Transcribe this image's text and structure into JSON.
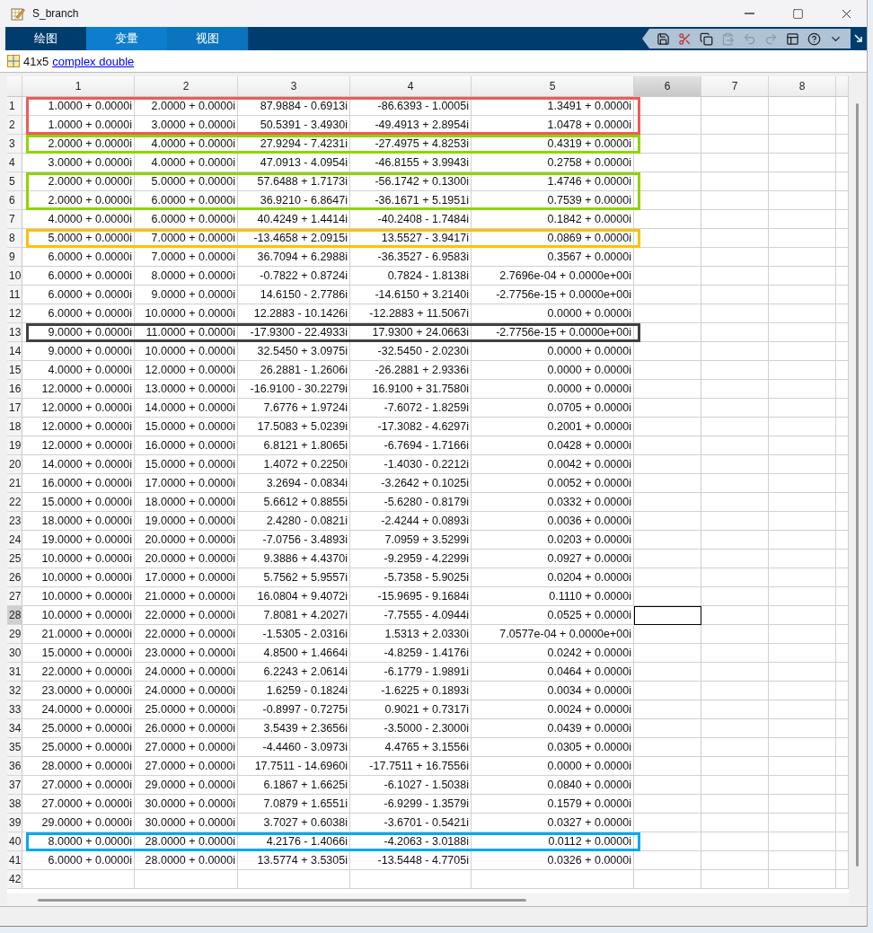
{
  "window": {
    "title": "S_branch"
  },
  "tabs": [
    {
      "label": "绘图",
      "selected": false,
      "highlighted": false
    },
    {
      "label": "变量",
      "selected": true,
      "highlighted": true
    },
    {
      "label": "视图",
      "selected": false,
      "highlighted": true
    }
  ],
  "toolbar": [
    {
      "kind": "save",
      "disabled": false
    },
    {
      "kind": "cut",
      "disabled": false
    },
    {
      "kind": "copy",
      "disabled": false
    },
    {
      "kind": "paste",
      "disabled": true
    },
    {
      "kind": "undo",
      "disabled": true
    },
    {
      "kind": "redo",
      "disabled": true
    },
    {
      "kind": "layout",
      "disabled": false
    },
    {
      "kind": "help",
      "disabled": false
    },
    {
      "kind": "menu",
      "disabled": false
    }
  ],
  "variable": {
    "size": "41x5",
    "type_link": "complex double"
  },
  "columns": [
    {
      "label": "1",
      "selected": false
    },
    {
      "label": "2",
      "selected": false
    },
    {
      "label": "3",
      "selected": false
    },
    {
      "label": "4",
      "selected": false
    },
    {
      "label": "5",
      "selected": false
    },
    {
      "label": "6",
      "selected": true
    },
    {
      "label": "7",
      "selected": false
    },
    {
      "label": "8",
      "selected": false
    }
  ],
  "rows": [
    {
      "label": "1",
      "selected": false,
      "color": "#f05a5a",
      "cells": [
        "1.0000 + 0.0000i",
        "2.0000 + 0.0000i",
        "87.9884 - 0.6913i",
        "-86.6393 - 1.0005i",
        "1.3491 + 0.0000i"
      ]
    },
    {
      "label": "2",
      "selected": false,
      "color": "#f05a5a",
      "cells": [
        "1.0000 + 0.0000i",
        "3.0000 + 0.0000i",
        "50.5391 - 3.4930i",
        "-49.4913 + 2.8954i",
        "1.0478 + 0.0000i"
      ]
    },
    {
      "label": "3",
      "selected": false,
      "color": "#8fd400",
      "cells": [
        "2.0000 + 0.0000i",
        "4.0000 + 0.0000i",
        "27.9294 - 7.4231i",
        "-27.4975 + 4.8253i",
        "0.4319 + 0.0000i"
      ]
    },
    {
      "label": "4",
      "selected": false,
      "cells": [
        "3.0000 + 0.0000i",
        "4.0000 + 0.0000i",
        "47.0913 - 4.0954i",
        "-46.8155 + 3.9943i",
        "0.2758 + 0.0000i"
      ]
    },
    {
      "label": "5",
      "selected": false,
      "color": "#8fd400",
      "cells": [
        "2.0000 + 0.0000i",
        "5.0000 + 0.0000i",
        "57.6488 + 1.7173i",
        "-56.1742 + 0.1300i",
        "1.4746 + 0.0000i"
      ]
    },
    {
      "label": "6",
      "selected": false,
      "color": "#8fd400",
      "cells": [
        "2.0000 + 0.0000i",
        "6.0000 + 0.0000i",
        "36.9210 - 6.8647i",
        "-36.1671 + 5.1951i",
        "0.7539 + 0.0000i"
      ]
    },
    {
      "label": "7",
      "selected": false,
      "cells": [
        "4.0000 + 0.0000i",
        "6.0000 + 0.0000i",
        "40.4249 + 1.4414i",
        "-40.2408 - 1.7484i",
        "0.1842 + 0.0000i"
      ]
    },
    {
      "label": "8",
      "selected": false,
      "color": "#ffc000",
      "cells": [
        "5.0000 + 0.0000i",
        "7.0000 + 0.0000i",
        "-13.4658 + 2.0915i",
        "13.5527 - 3.9417i",
        "0.0869 + 0.0000i"
      ]
    },
    {
      "label": "9",
      "selected": false,
      "cells": [
        "6.0000 + 0.0000i",
        "7.0000 + 0.0000i",
        "36.7094 + 6.2988i",
        "-36.3527 - 6.9583i",
        "0.3567 + 0.0000i"
      ]
    },
    {
      "label": "10",
      "selected": false,
      "cells": [
        "6.0000 + 0.0000i",
        "8.0000 + 0.0000i",
        "-0.7822 + 0.8724i",
        "0.7824 - 1.8138i",
        "2.7696e-04 + 0.0000e+00i"
      ]
    },
    {
      "label": "11",
      "selected": false,
      "cells": [
        "6.0000 + 0.0000i",
        "9.0000 + 0.0000i",
        "14.6150 - 2.7786i",
        "-14.6150 + 3.2140i",
        "-2.7756e-15 + 0.0000e+00i"
      ]
    },
    {
      "label": "12",
      "selected": false,
      "cells": [
        "6.0000 + 0.0000i",
        "10.0000 + 0.0000i",
        "12.2883 - 10.1426i",
        "-12.2883 + 11.5067i",
        "0.0000 + 0.0000i"
      ]
    },
    {
      "label": "13",
      "selected": false,
      "color": "#404040",
      "cells": [
        "9.0000 + 0.0000i",
        "11.0000 + 0.0000i",
        "-17.9300 - 22.4933i",
        "17.9300 + 24.0663i",
        "-2.7756e-15 + 0.0000e+00i"
      ]
    },
    {
      "label": "14",
      "selected": false,
      "cells": [
        "9.0000 + 0.0000i",
        "10.0000 + 0.0000i",
        "32.5450 + 3.0975i",
        "-32.5450 - 2.0230i",
        "0.0000 + 0.0000i"
      ]
    },
    {
      "label": "15",
      "selected": false,
      "cells": [
        "4.0000 + 0.0000i",
        "12.0000 + 0.0000i",
        "26.2881 - 1.2606i",
        "-26.2881 + 2.9336i",
        "0.0000 + 0.0000i"
      ]
    },
    {
      "label": "16",
      "selected": false,
      "cells": [
        "12.0000 + 0.0000i",
        "13.0000 + 0.0000i",
        "-16.9100 - 30.2279i",
        "16.9100 + 31.7580i",
        "0.0000 + 0.0000i"
      ]
    },
    {
      "label": "17",
      "selected": false,
      "cells": [
        "12.0000 + 0.0000i",
        "14.0000 + 0.0000i",
        "7.6776 + 1.9724i",
        "-7.6072 - 1.8259i",
        "0.0705 + 0.0000i"
      ]
    },
    {
      "label": "18",
      "selected": false,
      "cells": [
        "12.0000 + 0.0000i",
        "15.0000 + 0.0000i",
        "17.5083 + 5.0239i",
        "-17.3082 - 4.6297i",
        "0.2001 + 0.0000i"
      ]
    },
    {
      "label": "19",
      "selected": false,
      "cells": [
        "12.0000 + 0.0000i",
        "16.0000 + 0.0000i",
        "6.8121 + 1.8065i",
        "-6.7694 - 1.7166i",
        "0.0428 + 0.0000i"
      ]
    },
    {
      "label": "20",
      "selected": false,
      "cells": [
        "14.0000 + 0.0000i",
        "15.0000 + 0.0000i",
        "1.4072 + 0.2250i",
        "-1.4030 - 0.2212i",
        "0.0042 + 0.0000i"
      ]
    },
    {
      "label": "21",
      "selected": false,
      "cells": [
        "16.0000 + 0.0000i",
        "17.0000 + 0.0000i",
        "3.2694 - 0.0834i",
        "-3.2642 + 0.1025i",
        "0.0052 + 0.0000i"
      ]
    },
    {
      "label": "22",
      "selected": false,
      "cells": [
        "15.0000 + 0.0000i",
        "18.0000 + 0.0000i",
        "5.6612 + 0.8855i",
        "-5.6280 - 0.8179i",
        "0.0332 + 0.0000i"
      ]
    },
    {
      "label": "23",
      "selected": false,
      "cells": [
        "18.0000 + 0.0000i",
        "19.0000 + 0.0000i",
        "2.4280 - 0.0821i",
        "-2.4244 + 0.0893i",
        "0.0036 + 0.0000i"
      ]
    },
    {
      "label": "24",
      "selected": false,
      "cells": [
        "19.0000 + 0.0000i",
        "20.0000 + 0.0000i",
        "-7.0756 - 3.4893i",
        "7.0959 + 3.5299i",
        "0.0203 + 0.0000i"
      ]
    },
    {
      "label": "25",
      "selected": false,
      "cells": [
        "10.0000 + 0.0000i",
        "20.0000 + 0.0000i",
        "9.3886 + 4.4370i",
        "-9.2959 - 4.2299i",
        "0.0927 + 0.0000i"
      ]
    },
    {
      "label": "26",
      "selected": false,
      "cells": [
        "10.0000 + 0.0000i",
        "17.0000 + 0.0000i",
        "5.7562 + 5.9557i",
        "-5.7358 - 5.9025i",
        "0.0204 + 0.0000i"
      ]
    },
    {
      "label": "27",
      "selected": false,
      "cells": [
        "10.0000 + 0.0000i",
        "21.0000 + 0.0000i",
        "16.0804 + 9.4072i",
        "-15.9695 - 9.1684i",
        "0.1110 + 0.0000i"
      ]
    },
    {
      "label": "28",
      "selected": true,
      "cells": [
        "10.0000 + 0.0000i",
        "22.0000 + 0.0000i",
        "7.8081 + 4.2027i",
        "-7.7555 - 4.0944i",
        "0.0525 + 0.0000i"
      ]
    },
    {
      "label": "29",
      "selected": false,
      "cells": [
        "21.0000 + 0.0000i",
        "22.0000 + 0.0000i",
        "-1.5305 - 2.0316i",
        "1.5313 + 2.0330i",
        "7.0577e-04 + 0.0000e+00i"
      ]
    },
    {
      "label": "30",
      "selected": false,
      "cells": [
        "15.0000 + 0.0000i",
        "23.0000 + 0.0000i",
        "4.8500 + 1.4664i",
        "-4.8259 - 1.4176i",
        "0.0242 + 0.0000i"
      ]
    },
    {
      "label": "31",
      "selected": false,
      "cells": [
        "22.0000 + 0.0000i",
        "24.0000 + 0.0000i",
        "6.2243 + 2.0614i",
        "-6.1779 - 1.9891i",
        "0.0464 + 0.0000i"
      ]
    },
    {
      "label": "32",
      "selected": false,
      "cells": [
        "23.0000 + 0.0000i",
        "24.0000 + 0.0000i",
        "1.6259 - 0.1824i",
        "-1.6225 + 0.1893i",
        "0.0034 + 0.0000i"
      ]
    },
    {
      "label": "33",
      "selected": false,
      "cells": [
        "24.0000 + 0.0000i",
        "25.0000 + 0.0000i",
        "-0.8997 - 0.7275i",
        "0.9021 + 0.7317i",
        "0.0024 + 0.0000i"
      ]
    },
    {
      "label": "34",
      "selected": false,
      "cells": [
        "25.0000 + 0.0000i",
        "26.0000 + 0.0000i",
        "3.5439 + 2.3656i",
        "-3.5000 - 2.3000i",
        "0.0439 + 0.0000i"
      ]
    },
    {
      "label": "35",
      "selected": false,
      "cells": [
        "25.0000 + 0.0000i",
        "27.0000 + 0.0000i",
        "-4.4460 - 3.0973i",
        "4.4765 + 3.1556i",
        "0.0305 + 0.0000i"
      ]
    },
    {
      "label": "36",
      "selected": false,
      "cells": [
        "28.0000 + 0.0000i",
        "27.0000 + 0.0000i",
        "17.7511 - 14.6960i",
        "-17.7511 + 16.7556i",
        "0.0000 + 0.0000i"
      ]
    },
    {
      "label": "37",
      "selected": false,
      "cells": [
        "27.0000 + 0.0000i",
        "29.0000 + 0.0000i",
        "6.1867 + 1.6625i",
        "-6.1027 - 1.5038i",
        "0.0840 + 0.0000i"
      ]
    },
    {
      "label": "38",
      "selected": false,
      "cells": [
        "27.0000 + 0.0000i",
        "30.0000 + 0.0000i",
        "7.0879 + 1.6551i",
        "-6.9299 - 1.3579i",
        "0.1579 + 0.0000i"
      ]
    },
    {
      "label": "39",
      "selected": false,
      "cells": [
        "29.0000 + 0.0000i",
        "30.0000 + 0.0000i",
        "3.7027 + 0.6038i",
        "-3.6701 - 0.5421i",
        "0.0327 + 0.0000i"
      ]
    },
    {
      "label": "40",
      "selected": false,
      "color": "#00a8f0",
      "cells": [
        "8.0000 + 0.0000i",
        "28.0000 + 0.0000i",
        "4.2176 - 1.4066i",
        "-4.2063 - 3.0188i",
        "0.0112 + 0.0000i"
      ]
    },
    {
      "label": "41",
      "selected": false,
      "cells": [
        "6.0000 + 0.0000i",
        "28.0000 + 0.0000i",
        "13.5774 + 3.5305i",
        "-13.5448 - 4.7705i",
        "0.0326 + 0.0000i"
      ]
    },
    {
      "label": "42",
      "selected": false,
      "cells": []
    }
  ]
}
